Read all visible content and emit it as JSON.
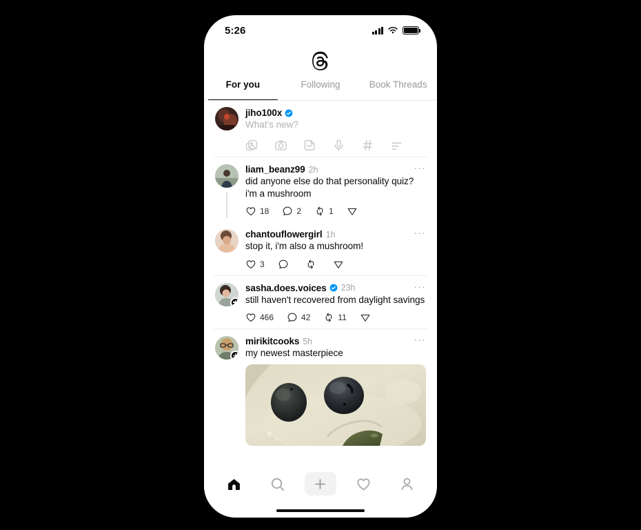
{
  "status_bar": {
    "time": "5:26",
    "signal_icon": "cellular-signal-icon",
    "wifi_icon": "wifi-icon",
    "battery_icon": "battery-full-icon"
  },
  "header": {
    "logo": "threads-logo",
    "tabs": [
      {
        "label": "For you",
        "active": true
      },
      {
        "label": "Following",
        "active": false
      },
      {
        "label": "Book Threads",
        "active": false
      }
    ]
  },
  "composer": {
    "username": "jiho100x",
    "verified": true,
    "placeholder": "What's new?",
    "tools": [
      "gallery-icon",
      "camera-icon",
      "gif-icon",
      "microphone-icon",
      "hashtag-icon",
      "poll-icon"
    ]
  },
  "posts": [
    {
      "username": "liam_beanz99",
      "verified": false,
      "timestamp": "2h",
      "text": "did anyone else do that personality quiz? i'm a mushroom",
      "has_thread_line": true,
      "follow_badge": false,
      "menu": "···",
      "actions": {
        "like": "18",
        "comment": "2",
        "repost": "1",
        "share": ""
      }
    },
    {
      "username": "chantouflowergirl",
      "verified": false,
      "timestamp": "1h",
      "text": "stop it, i'm also a mushroom!",
      "has_thread_line": false,
      "follow_badge": false,
      "menu": "···",
      "actions": {
        "like": "3",
        "comment": "",
        "repost": "",
        "share": ""
      }
    },
    {
      "username": "sasha.does.voices",
      "verified": true,
      "timestamp": "23h",
      "text": "still haven't recovered from daylight savings",
      "has_thread_line": false,
      "follow_badge": true,
      "menu": "···",
      "actions": {
        "like": "466",
        "comment": "42",
        "repost": "11",
        "share": ""
      }
    },
    {
      "username": "mirikitcooks",
      "verified": false,
      "timestamp": "5h",
      "text": "my newest masterpiece",
      "has_thread_line": false,
      "follow_badge": true,
      "menu": "···",
      "has_media": true,
      "media_description": "two dark olives on a cream plate",
      "actions": {
        "like": "",
        "comment": "",
        "repost": "",
        "share": ""
      }
    }
  ],
  "bottom_nav": [
    {
      "icon": "home-icon",
      "active": true
    },
    {
      "icon": "search-icon",
      "active": false
    },
    {
      "icon": "compose-plus-icon",
      "active": false
    },
    {
      "icon": "heart-activity-icon",
      "active": false
    },
    {
      "icon": "profile-person-icon",
      "active": false
    }
  ],
  "colors": {
    "verified_blue": "#0095F6",
    "background": "#000000",
    "surface": "#FFFFFF",
    "text_primary": "#0A0A0A",
    "text_muted": "#A3A3A3"
  }
}
